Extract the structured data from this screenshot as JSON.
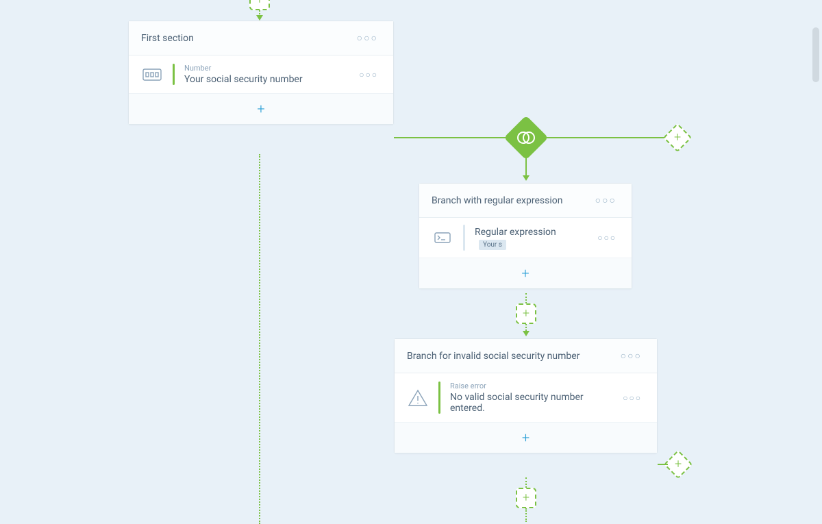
{
  "cards": {
    "first_section": {
      "title": "First section",
      "field_type": "Number",
      "field_label": "Your social security number"
    },
    "branch_regex": {
      "title": "Branch with regular expression",
      "row_label": "Regular expression",
      "chip": "Your s"
    },
    "branch_invalid": {
      "title": "Branch for invalid social security number",
      "row_type": "Raise error",
      "row_label": "No valid social security number entered."
    }
  }
}
